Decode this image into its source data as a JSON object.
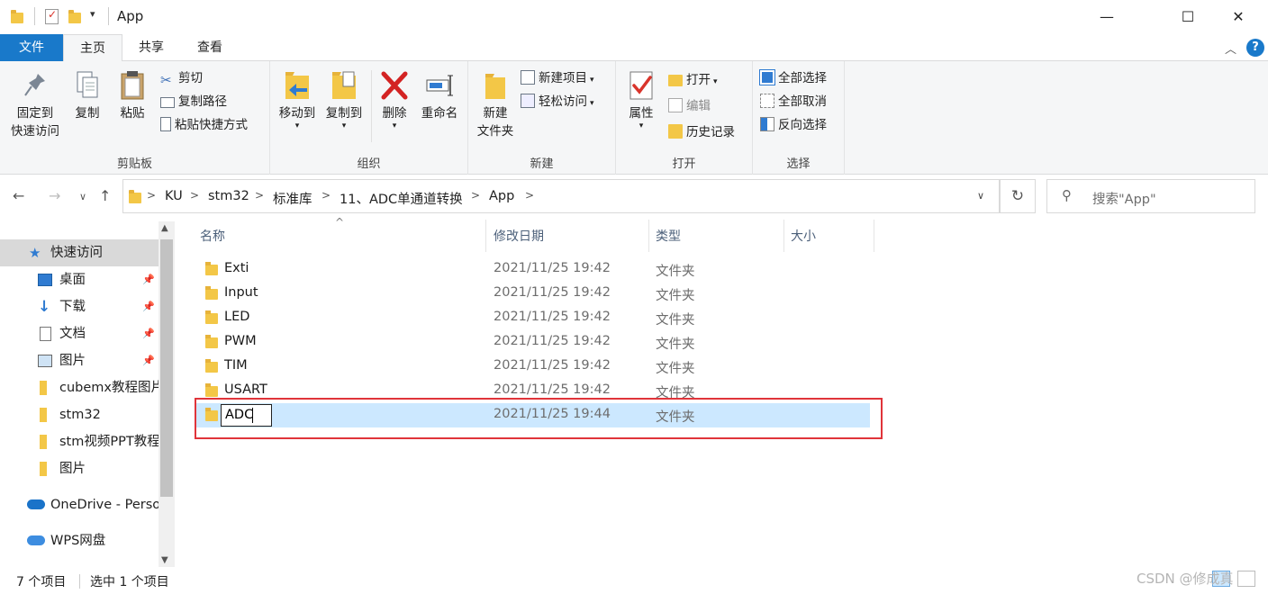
{
  "window": {
    "title": "App",
    "minimize": "—",
    "maximize": "☐",
    "close": "✕"
  },
  "ribbon_tabs": [
    {
      "label": "文件"
    },
    {
      "label": "主页"
    },
    {
      "label": "共享"
    },
    {
      "label": "查看"
    }
  ],
  "ribbon": {
    "clipboard": {
      "label": "剪贴板",
      "pin": "固定到\n快速访问",
      "pin_l1": "固定到",
      "pin_l2": "快速访问",
      "copy": "复制",
      "paste": "粘贴",
      "cut": "剪切",
      "copy_path": "复制路径",
      "paste_shortcut": "粘贴快捷方式"
    },
    "organize": {
      "label": "组织",
      "move_to": "移动到",
      "copy_to": "复制到",
      "delete": "删除",
      "rename": "重命名"
    },
    "new": {
      "label": "新建",
      "new_folder_l1": "新建",
      "new_folder_l2": "文件夹",
      "new_item": "新建项目",
      "easy_access": "轻松访问"
    },
    "open": {
      "label": "打开",
      "properties": "属性",
      "open": "打开",
      "edit": "编辑",
      "history": "历史记录"
    },
    "select": {
      "label": "选择",
      "select_all": "全部选择",
      "select_none": "全部取消",
      "invert": "反向选择"
    }
  },
  "address": {
    "crumbs": [
      "KU",
      "stm32",
      "标准库",
      "11、ADC单通道转换",
      "App"
    ],
    "search_placeholder": "搜索\"App\""
  },
  "nav_pane": {
    "quick_access": "快速访问",
    "items": [
      {
        "label": "桌面",
        "pinned": true
      },
      {
        "label": "下载",
        "pinned": true
      },
      {
        "label": "文档",
        "pinned": true
      },
      {
        "label": "图片",
        "pinned": true
      },
      {
        "label": "cubemx教程图片"
      },
      {
        "label": "stm32"
      },
      {
        "label": "stm视频PPT教程"
      },
      {
        "label": "图片"
      }
    ],
    "onedrive": "OneDrive - Personal",
    "wps": "WPS网盘"
  },
  "file_list": {
    "columns": {
      "name": "名称",
      "date": "修改日期",
      "type": "类型",
      "size": "大小"
    },
    "rows": [
      {
        "name": "Exti",
        "date": "2021/11/25 19:42",
        "type": "文件夹"
      },
      {
        "name": "Input",
        "date": "2021/11/25 19:42",
        "type": "文件夹"
      },
      {
        "name": "LED",
        "date": "2021/11/25 19:42",
        "type": "文件夹"
      },
      {
        "name": "PWM",
        "date": "2021/11/25 19:42",
        "type": "文件夹"
      },
      {
        "name": "TIM",
        "date": "2021/11/25 19:42",
        "type": "文件夹"
      },
      {
        "name": "USART",
        "date": "2021/11/25 19:42",
        "type": "文件夹"
      },
      {
        "name": "ADC",
        "date": "2021/11/25 19:44",
        "type": "文件夹",
        "renaming": true
      }
    ]
  },
  "status": {
    "item_count": "7 个项目",
    "selected": "选中 1 个项目"
  },
  "watermark": "CSDN @修成真"
}
